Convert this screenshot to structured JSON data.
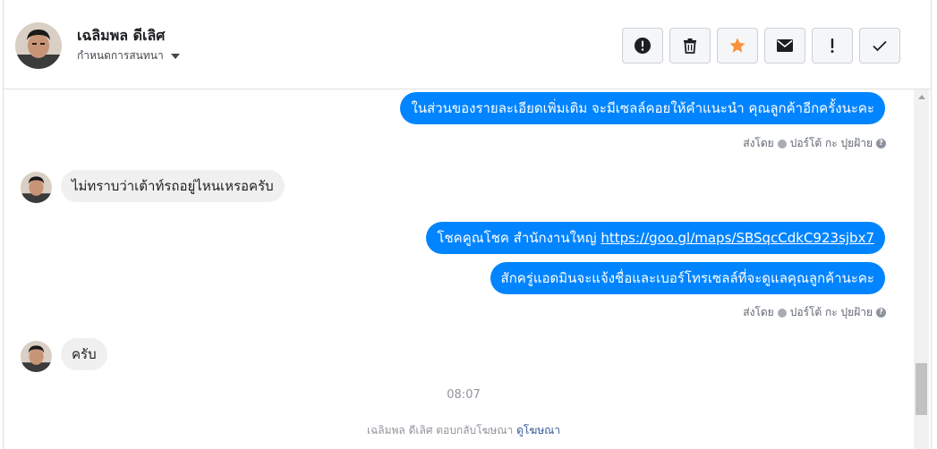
{
  "header": {
    "name": "เฉลิมพล ดีเลิศ",
    "subtitle": "กำหนดการสนทนา",
    "actions": [
      {
        "icon": "exclamation-circle-icon",
        "label": "spam"
      },
      {
        "icon": "trash-icon",
        "label": "delete"
      },
      {
        "icon": "star-icon",
        "label": "star",
        "color": "#f7923b"
      },
      {
        "icon": "envelope-icon",
        "label": "unread"
      },
      {
        "icon": "exclamation-icon",
        "label": "follow up"
      },
      {
        "icon": "checkmark-icon",
        "label": "done"
      }
    ]
  },
  "messages": {
    "m1": "ในส่วนของรายละเอียดเพิ่มเติม จะมีเซลล์คอยให้คำแนะนำ คุณลูกค้าอีกครั้งนะคะ",
    "m2": "ไม่ทราบว่าเต้าท์รถอยู่ไหนเหรอครับ",
    "m3_prefix": "โชคคูณโชค สำนักงานใหญ่ ",
    "m3_link": "https://goo.gl/maps/SBSqcCdkC923sjbx7",
    "m4": "สักครู่แอดมินจะแจ้งชื่อและเบอร์โทรเซลล์ที่จะดูแลคุณลูกค้านะคะ",
    "m5": "ครับ"
  },
  "sent_by": {
    "label": "ส่งโดย",
    "agent": "ปอร์โต้ กะ ปุยฝ้าย"
  },
  "timestamp": "08:07",
  "footer": {
    "text": "เฉลิมพล ดีเลิศ ตอบกลับโฆษณา",
    "link": "ดูโฆษณา"
  },
  "colors": {
    "outgoing_bubble": "#0084ff",
    "incoming_bubble": "#f1f0f0",
    "star": "#f7923b"
  }
}
